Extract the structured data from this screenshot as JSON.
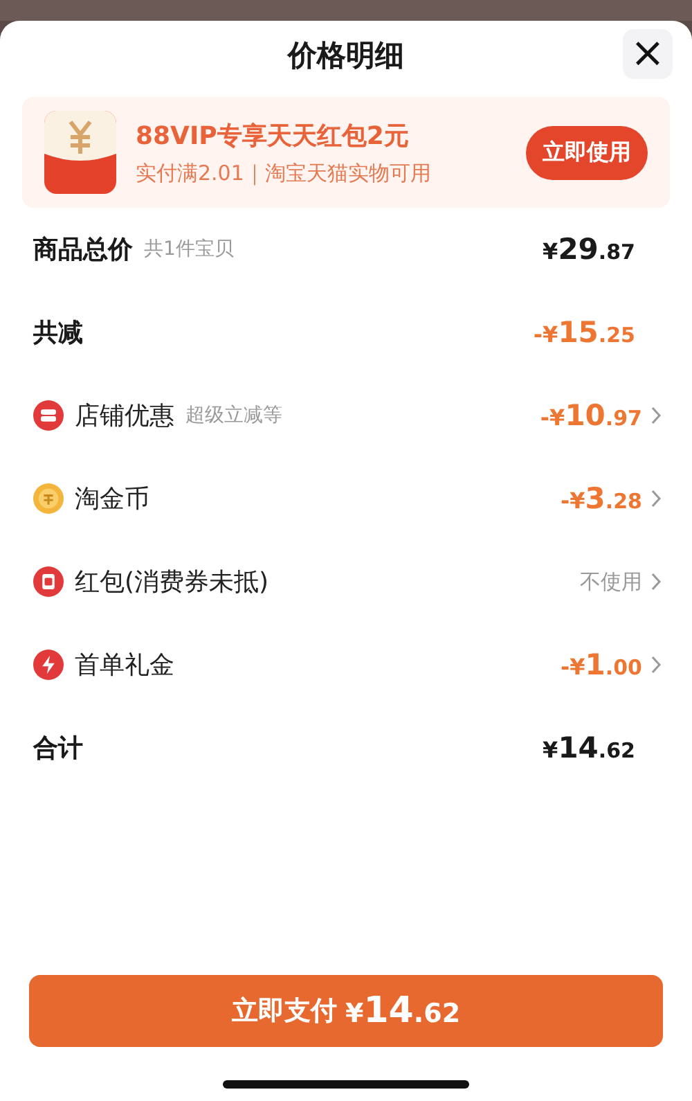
{
  "sheet": {
    "title": "价格明细",
    "close": "×"
  },
  "promo": {
    "title": "88VIP专享天天红包2元",
    "subtitle": "实付满2.01｜淘宝天猫实物可用",
    "button": "立即使用"
  },
  "rows": [
    {
      "kind": "summary",
      "label": "商品总价",
      "note": "共1件宝贝",
      "amount": "¥29.87",
      "discount": false
    },
    {
      "kind": "summary",
      "label": "共减",
      "amount": "-¥15.25",
      "discount": true
    },
    {
      "kind": "store",
      "label": "店铺优惠",
      "note": "超级立减等",
      "amount": "-¥10.97",
      "discount": true
    },
    {
      "kind": "coin",
      "label": "淘金币",
      "amount": "-¥3.28",
      "discount": true
    },
    {
      "kind": "envelope",
      "label": "红包(消费券未抵)",
      "value": "不使用"
    },
    {
      "kind": "gift",
      "label": "首单礼金",
      "amount": "-¥1.00",
      "discount": true
    },
    {
      "kind": "summary",
      "label": "合计",
      "amount": "¥14.62",
      "discount": false
    }
  ],
  "pay_button": {
    "label": "立即支付",
    "amount": "¥14.62"
  }
}
